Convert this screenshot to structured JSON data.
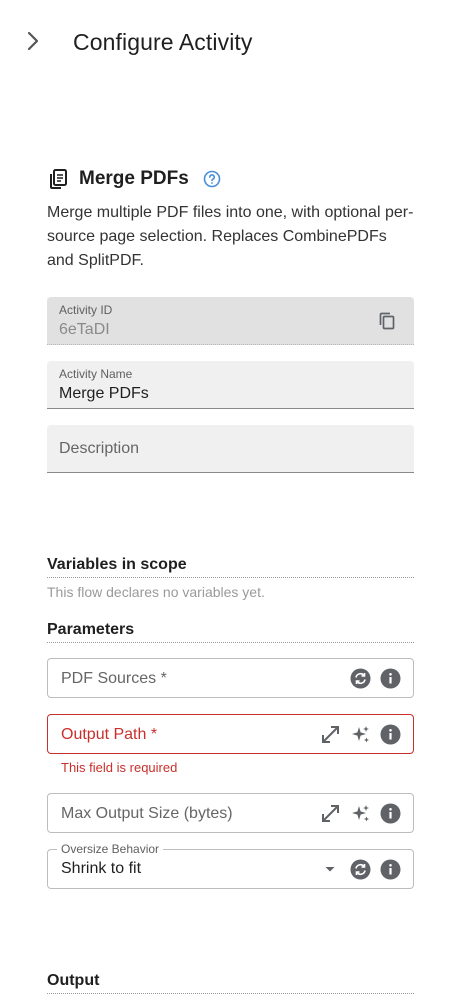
{
  "header": {
    "title": "Configure Activity",
    "collapse_icon": "chevron-right-icon"
  },
  "activity": {
    "title": "Merge PDFs",
    "icon": "copy-pages-icon",
    "help_icon": "help-circle-icon",
    "description": "Merge multiple PDF files into one, with optional per-source page selection. Replaces CombinePDFs and SplitPDF."
  },
  "fields": {
    "activity_id": {
      "label": "Activity ID",
      "value": "6eTaDI"
    },
    "activity_name": {
      "label": "Activity Name",
      "value": "Merge PDFs"
    },
    "description": {
      "placeholder": "Description"
    }
  },
  "variables": {
    "title": "Variables in scope",
    "empty_text": "This flow declares no variables yet."
  },
  "parameters": {
    "title": "Parameters",
    "pdf_sources": {
      "label": "PDF Sources *"
    },
    "output_path": {
      "label": "Output Path *",
      "error": "This field is required"
    },
    "max_output_size": {
      "label": "Max Output Size (bytes)"
    },
    "oversize_behavior": {
      "label": "Oversize Behavior",
      "value": "Shrink to fit"
    }
  },
  "output": {
    "title": "Output"
  },
  "colors": {
    "error": "#c9302c",
    "accent": "#4a8fd9",
    "icon": "#5f6368"
  }
}
